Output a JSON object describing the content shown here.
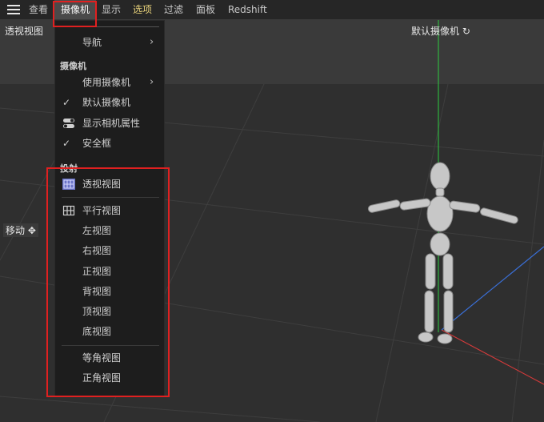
{
  "menubar": {
    "items": [
      "查看",
      "摄像机",
      "显示",
      "选项",
      "过滤",
      "面板",
      "Redshift"
    ],
    "active_index": 1,
    "highlight_index": 3
  },
  "viewport": {
    "label": "透视视图",
    "camera_label": "默认摄像机",
    "move_label": "移动"
  },
  "dropdown": {
    "nav_label": "导航",
    "camera_section": "摄像机",
    "use_camera": "使用摄像机",
    "default_camera": "默认摄像机",
    "show_camera_props": "显示相机属性",
    "safe_frame": "安全框",
    "projection_section": "投射",
    "views": [
      "透视视图",
      "平行视图",
      "左视图",
      "右视图",
      "正视图",
      "背视图",
      "顶视图",
      "底视图"
    ],
    "iso_views": [
      "等角视图",
      "正角视图"
    ]
  },
  "colors": {
    "y_axis": "#2ecc40",
    "x_axis": "#d63a3a",
    "z_axis": "#3a6fd6",
    "highlight": "#e02020",
    "selected_icon": "#6b74c9"
  }
}
